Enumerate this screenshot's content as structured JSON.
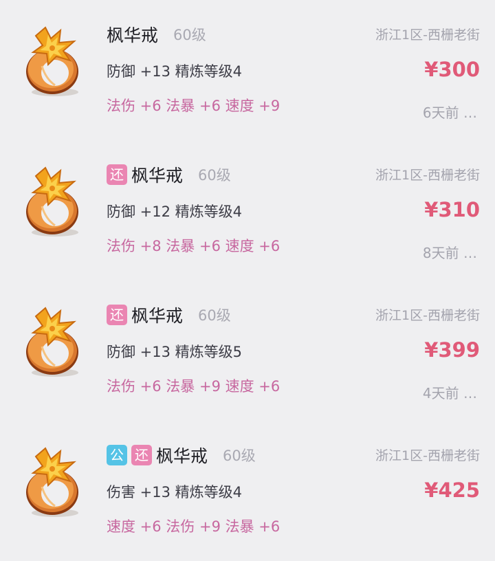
{
  "listings": [
    {
      "tags": [],
      "name": "枫华戒",
      "level": "60级",
      "server": "浙江1区-西栅老街",
      "stat_line1": "防御 +13 精炼等级4",
      "price": "¥300",
      "stat_line2": "法伤 +6 法暴 +6 速度 +9",
      "time": "6天前 …"
    },
    {
      "tags": [
        "还"
      ],
      "name": "枫华戒",
      "level": "60级",
      "server": "浙江1区-西栅老街",
      "stat_line1": "防御 +12 精炼等级4",
      "price": "¥310",
      "stat_line2": "法伤 +8 法暴 +6 速度 +6",
      "time": "8天前 …"
    },
    {
      "tags": [
        "还"
      ],
      "name": "枫华戒",
      "level": "60级",
      "server": "浙江1区-西栅老街",
      "stat_line1": "防御 +13 精炼等级5",
      "price": "¥399",
      "stat_line2": "法伤 +6 法暴 +9 速度 +6",
      "time": "4天前 …"
    },
    {
      "tags": [
        "公",
        "还"
      ],
      "name": "枫华戒",
      "level": "60级",
      "server": "浙江1区-西栅老街",
      "stat_line1": "伤害 +13 精炼等级4",
      "price": "¥425",
      "stat_line2": "速度 +6 法伤 +9 法暴 +6",
      "time": ""
    }
  ],
  "item_icon": "maple-leaf-ring-icon",
  "colors": {
    "background": "#efeff1",
    "price": "#e05a78",
    "special_stats": "#c7679f",
    "tag_huan": "#ea85b2",
    "tag_gong": "#55c3e6"
  }
}
